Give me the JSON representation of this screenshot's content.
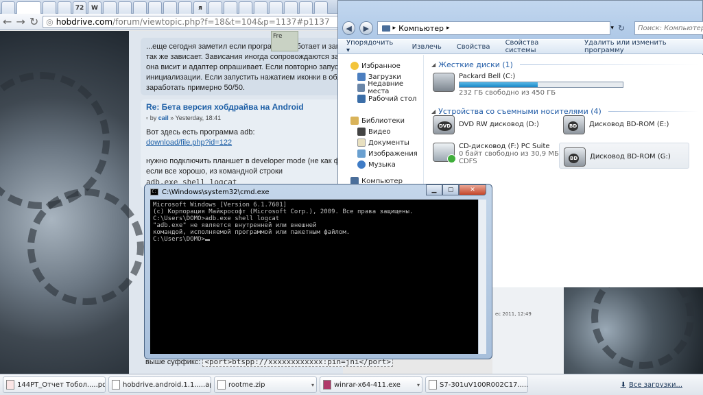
{
  "browser": {
    "tabs": [
      "",
      "",
      "",
      "",
      "72",
      "W",
      "",
      "",
      "",
      "",
      "",
      "",
      "я",
      "",
      "",
      "",
      "",
      "",
      "",
      "",
      ""
    ],
    "url_host": "hobdrive.com",
    "url_path": "/forum/viewtopic.php?f=18&t=104&p=1137#p1137"
  },
  "forum": {
    "post1_lines": [
      "...еще сегодня заметил если программа работает и заглушит",
      "так же зависает. Зависания иногда сопровождаются закрыти",
      "она висит и адаптер опрашивает. Если повторно запустить пр",
      "инициализации. Если запустить нажатием иконки в области з",
      "заработать примерно 50/50."
    ],
    "post2_title": "Re: Бета версия хобдрайва на Android",
    "post2_meta_prefix": "by",
    "post2_author": "cail",
    "post2_date": "» Yesterday, 18:41",
    "post2_line1": "Вот здесь есть программа adb:",
    "post2_link": "download/file.php?id=122",
    "post2_line2": "нужно подключить планшет в developer mode (не как флешку",
    "post2_line3": "если все хорошо, из командной строки",
    "post2_code": "adb.exe shell logcat",
    "sidenote": "Fre",
    "bottom_prefix": "выше суффикс:",
    "bottom_code": "<port>btspp://xxxxxxxxxxxx:pin=jni</port>",
    "right_date": "ес 2011, 12:49"
  },
  "explorer": {
    "breadcrumb": "Компьютер",
    "search_placeholder": "Поиск: Компьютер",
    "toolbar": [
      "Упорядочить ▾",
      "Извлечь",
      "Свойства",
      "Свойства системы",
      "Удалить или изменить программу"
    ],
    "nav": {
      "favorites": "Избранное",
      "favorites_items": [
        "Загрузки",
        "Недавние места",
        "Рабочий стол"
      ],
      "libraries": "Библиотеки",
      "libraries_items": [
        "Видео",
        "Документы",
        "Изображения",
        "Музыка"
      ],
      "computer": "Компьютер"
    },
    "section_hdd": "Жесткие диски (1)",
    "section_removable": "Устройства со съемными носителями (4)",
    "drive_c": {
      "name": "Packard Bell (C:)",
      "free": "232 ГБ свободно из 450 ГБ",
      "used_fraction": 0.48
    },
    "drive_d": {
      "name": "DVD RW дисковод (D:)",
      "badge": "DVD"
    },
    "drive_e": {
      "name": "Дисковод BD-ROM (E:)",
      "badge": "BD"
    },
    "drive_f": {
      "name": "CD-дисковод (F:) PC Suite",
      "free": "0 байт свободно из 30,9 МБ",
      "fs": "CDFS"
    },
    "drive_g": {
      "name": "Дисковод BD-ROM (G:)",
      "badge": "BD"
    }
  },
  "cmd": {
    "title": "C:\\Windows\\system32\\cmd.exe",
    "lines": [
      "Microsoft Windows [Version 6.1.7601]",
      "(c) Корпорация Майкрософт (Microsoft Corp.), 2009. Все права защищены.",
      "",
      "C:\\Users\\DOMO>adb.exe shell logcat",
      "\"adb.exe\" не является внутренней или внешней",
      "командой, исполняемой программой или пакетным файлом.",
      "",
      "C:\\Users\\DOMO>"
    ]
  },
  "downloads": {
    "items": [
      "144PT_Отчет Тобол.....pdf",
      "hobdrive.android.1.1.....apk",
      "rootme.zip",
      "winrar-x64-411.exe",
      "S7-301uV100R002C17.....rar"
    ],
    "all_label": "Все загрузки..."
  },
  "colors": {
    "link": "#1d5fa6",
    "accent": "#1e5aa6"
  }
}
